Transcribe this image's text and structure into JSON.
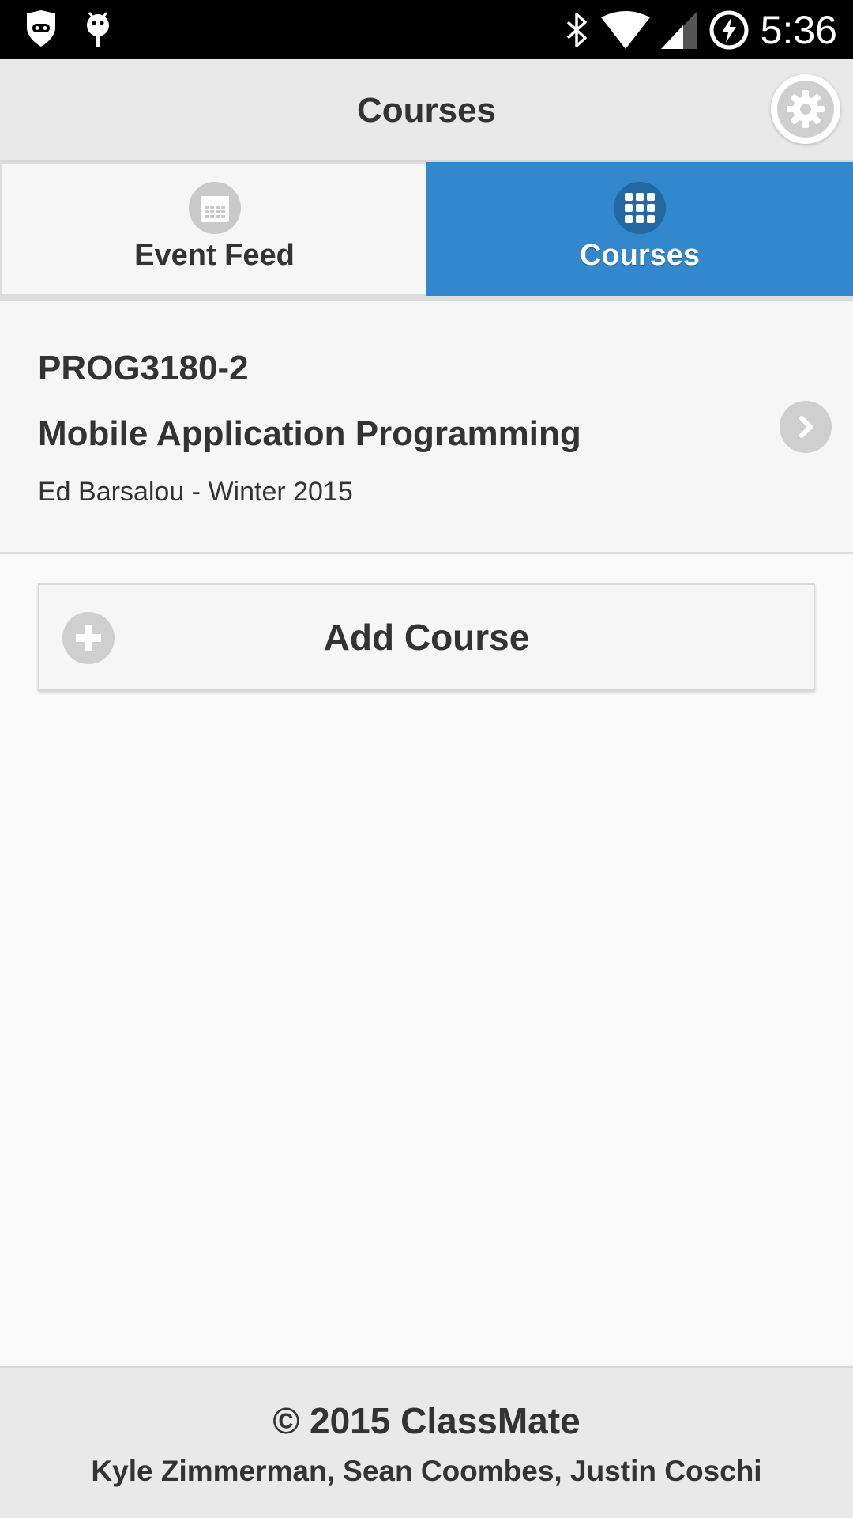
{
  "status_bar": {
    "time": "5:36",
    "icons": [
      "cyanogen-icon",
      "android-debug-icon",
      "bluetooth-icon",
      "wifi-icon",
      "cell-signal-icon",
      "battery-charging-icon"
    ]
  },
  "header": {
    "title": "Courses",
    "settings_icon": "gear-icon"
  },
  "tabs": [
    {
      "label": "Event Feed",
      "icon": "calendar-icon",
      "active": false
    },
    {
      "label": "Courses",
      "icon": "grid-icon",
      "active": true
    }
  ],
  "courses": [
    {
      "code": "PROG3180-2",
      "name": "Mobile Application Programming",
      "meta": "Ed Barsalou - Winter 2015",
      "action_icon": "chevron-right-icon"
    }
  ],
  "add_course": {
    "label": "Add Course",
    "icon": "plus-icon"
  },
  "footer": {
    "copyright": "© 2015 ClassMate",
    "authors": "Kyle Zimmerman, Sean Coombes, Justin Coschi"
  },
  "colors": {
    "accent": "#3387cc",
    "header_bg": "#e9e9e9",
    "text": "#333333"
  }
}
